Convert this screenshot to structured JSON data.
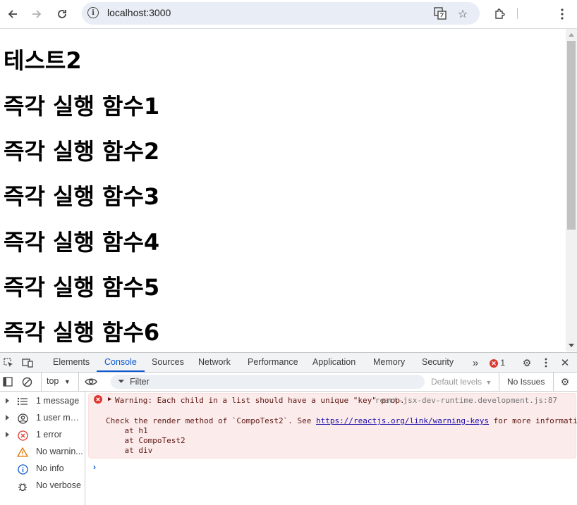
{
  "browser": {
    "url": "localhost:3000"
  },
  "page": {
    "headings": [
      "테스트2",
      "즉각 실행 함수1",
      "즉각 실행 함수2",
      "즉각 실행 함수3",
      "즉각 실행 함수4",
      "즉각 실행 함수5",
      "즉각 실행 함수6"
    ]
  },
  "devtools": {
    "tabs": [
      "Elements",
      "Console",
      "Sources",
      "Network",
      "Performance",
      "Application",
      "Memory",
      "Security"
    ],
    "active_tab": "Console",
    "error_count": "1",
    "context": "top",
    "filter_placeholder": "Filter",
    "levels": "Default levels",
    "issues": "No Issues",
    "sidebar": [
      "1 message",
      "1 user mes...",
      "1 error",
      "No warnin...",
      "No info",
      "No verbose"
    ],
    "message": {
      "line1": "Warning: Each child in a list should have a unique \"key\" prop.",
      "source": "react-jsx-dev-runtime.development.js:87",
      "line2_pre": "Check the render method of `CompoTest2`. See ",
      "link": "https://reactjs.org/link/warning-keys",
      "line2_post": " for more information.",
      "stack": [
        "    at h1",
        "    at CompoTest2",
        "    at div"
      ]
    },
    "colors": {
      "accent": "#0b57d0",
      "error": "#dc362e",
      "error_bg": "#fcebeb"
    }
  }
}
